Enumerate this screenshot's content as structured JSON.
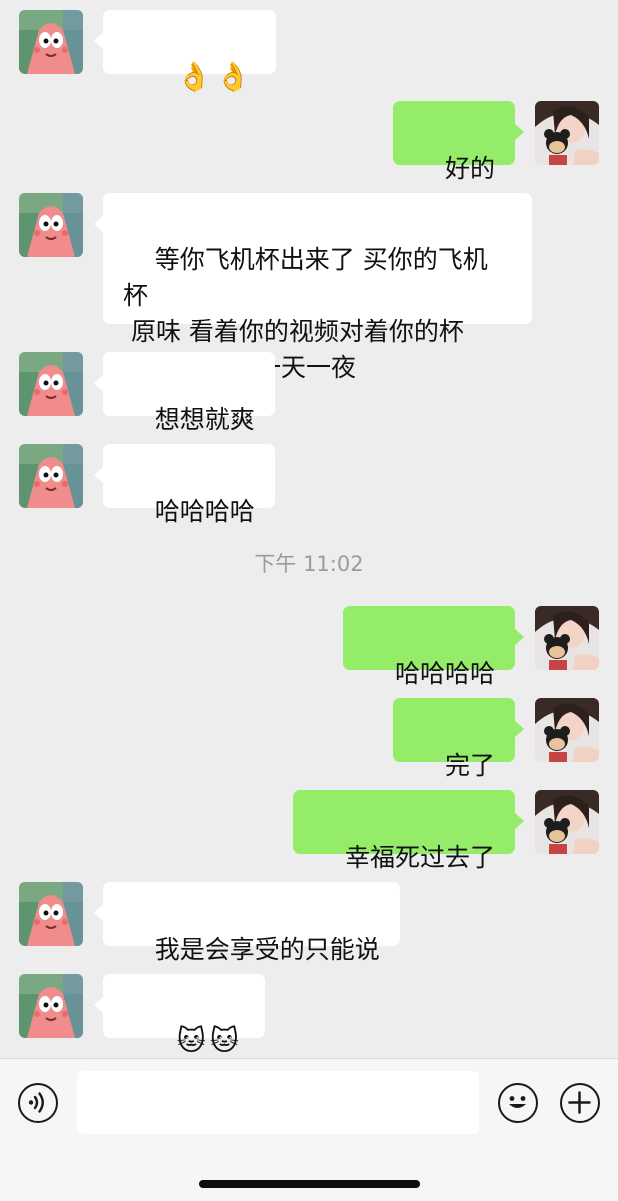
{
  "messages": [
    {
      "side": "in",
      "text": "👌👌"
    },
    {
      "side": "out",
      "text": "好的"
    },
    {
      "side": "in",
      "text": "等你飞机杯出来了 买你的飞机杯\n 原味 看着你的视频对着你的杯\n子 原味冲上一天一夜"
    },
    {
      "side": "in",
      "text": "想想就爽"
    },
    {
      "side": "in",
      "text": "哈哈哈哈"
    },
    {
      "side": "out",
      "text": "哈哈哈哈"
    },
    {
      "side": "out",
      "text": "完了"
    },
    {
      "side": "out",
      "text": "幸福死过去了"
    },
    {
      "side": "in",
      "text": "我是会享受的只能说"
    },
    {
      "side": "in",
      "text": "🐱🐱"
    }
  ],
  "timestamp": "下午 11:02",
  "input": {
    "value": ""
  },
  "icons": {
    "voice": "voice-icon",
    "emoji": "emoji-icon",
    "add": "plus-icon"
  },
  "colors": {
    "background": "#ededed",
    "incoming_bubble": "#ffffff",
    "outgoing_bubble": "#95ec69"
  }
}
